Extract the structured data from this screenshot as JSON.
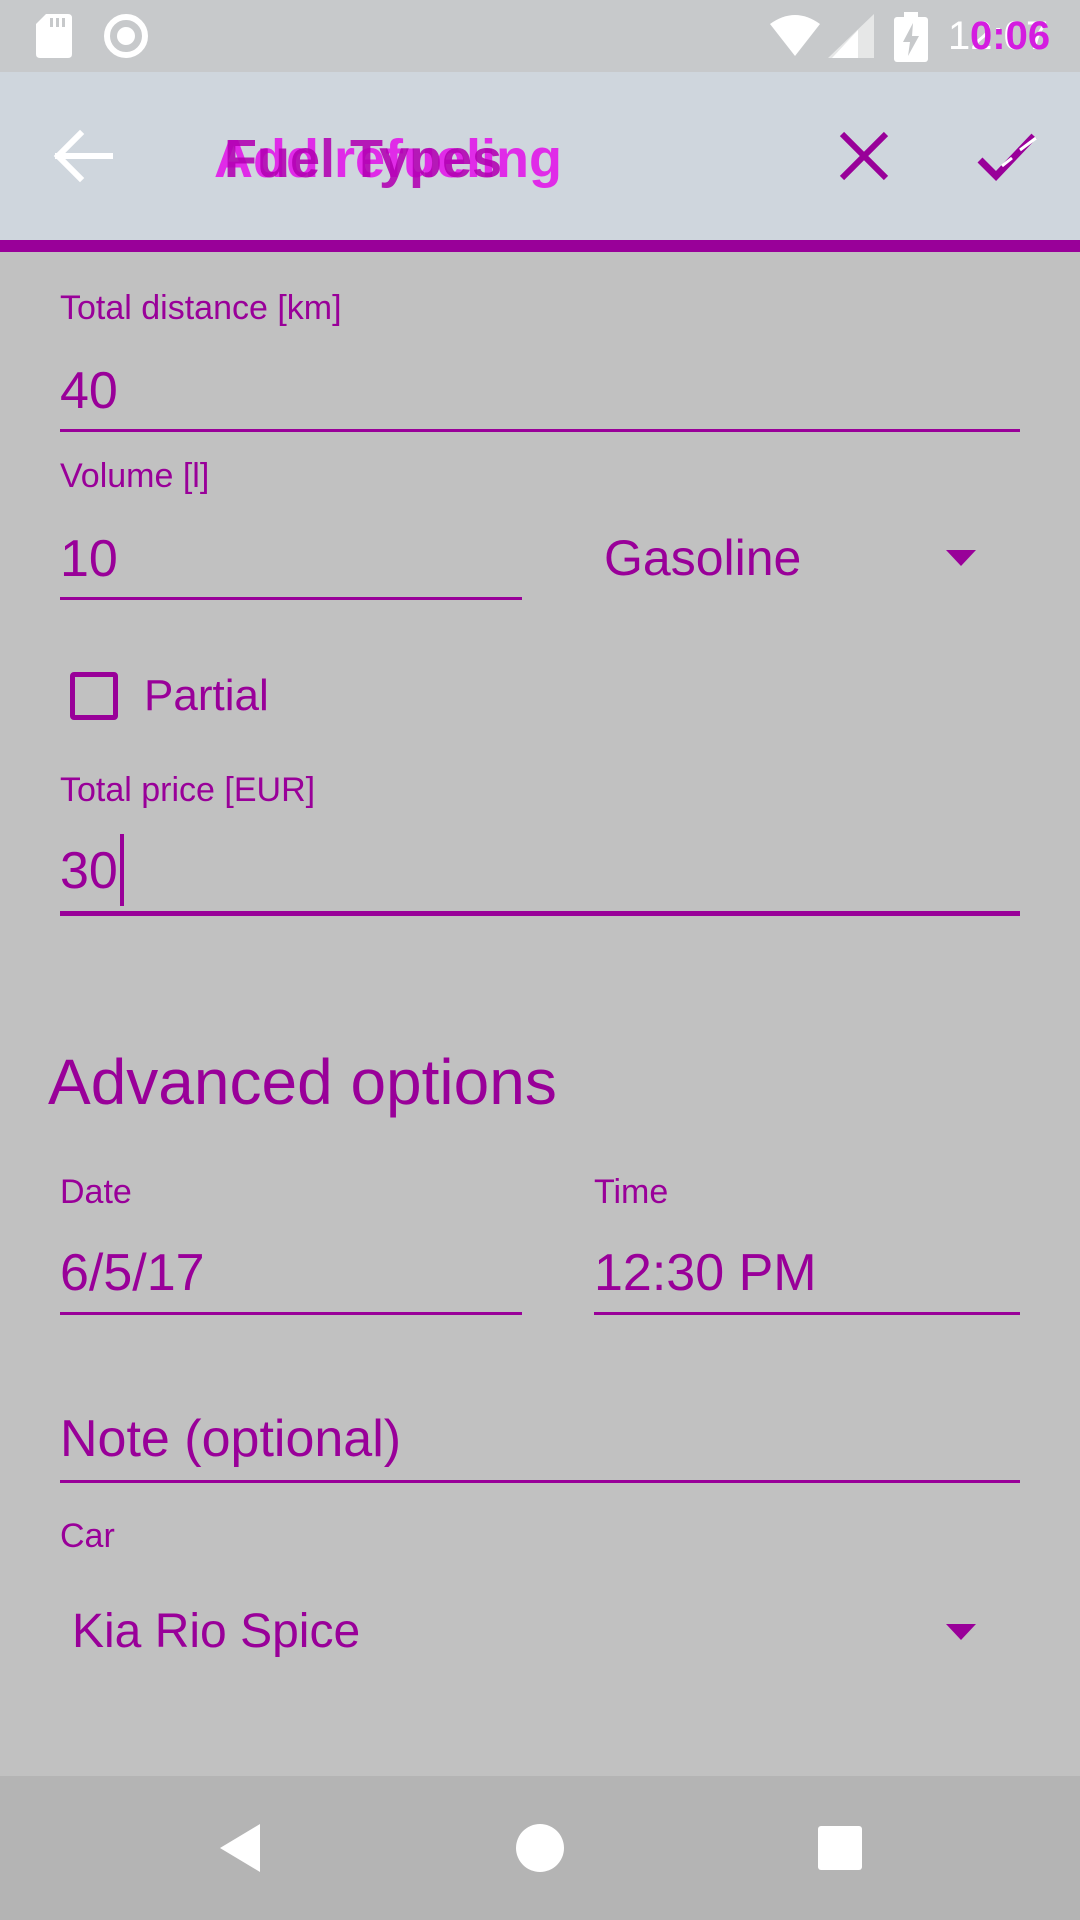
{
  "status_bar": {
    "time_base": "12:07",
    "time_overlay": "0:06",
    "icons": [
      "sd-card-icon",
      "circle-icon",
      "wifi-icon",
      "signal-icon",
      "battery-charging-icon"
    ]
  },
  "app_bar": {
    "title_a": "Add refueling",
    "title_b": "Fuel Types",
    "icons": [
      "back-arrow-icon",
      "close-icon",
      "done-all-icon"
    ]
  },
  "form": {
    "total_distance": {
      "label": "Total distance [km]",
      "value": "40"
    },
    "volume": {
      "label": "Volume [l]",
      "value": "10"
    },
    "fuel_type": {
      "selected": "Gasoline"
    },
    "partial": {
      "label": "Partial",
      "checked": false
    },
    "total_price": {
      "label": "Total price [EUR]",
      "value": "30"
    },
    "advanced_title": "Advanced options",
    "date": {
      "label": "Date",
      "value": "6/5/17"
    },
    "time": {
      "label": "Time",
      "value": "12:30 PM"
    },
    "note": {
      "placeholder": "Note (optional)"
    },
    "car": {
      "label": "Car",
      "selected": "Kia Rio Spice"
    }
  },
  "colors": {
    "accent": "#990099",
    "background": "#c1c1c1",
    "app_bar": "#cfd6dd",
    "status_bar": "#c7c9cb",
    "nav_bar": "#b4b4b4"
  },
  "nav_bar": {
    "icons": [
      "nav-back-icon",
      "nav-home-icon",
      "nav-recents-icon"
    ]
  }
}
